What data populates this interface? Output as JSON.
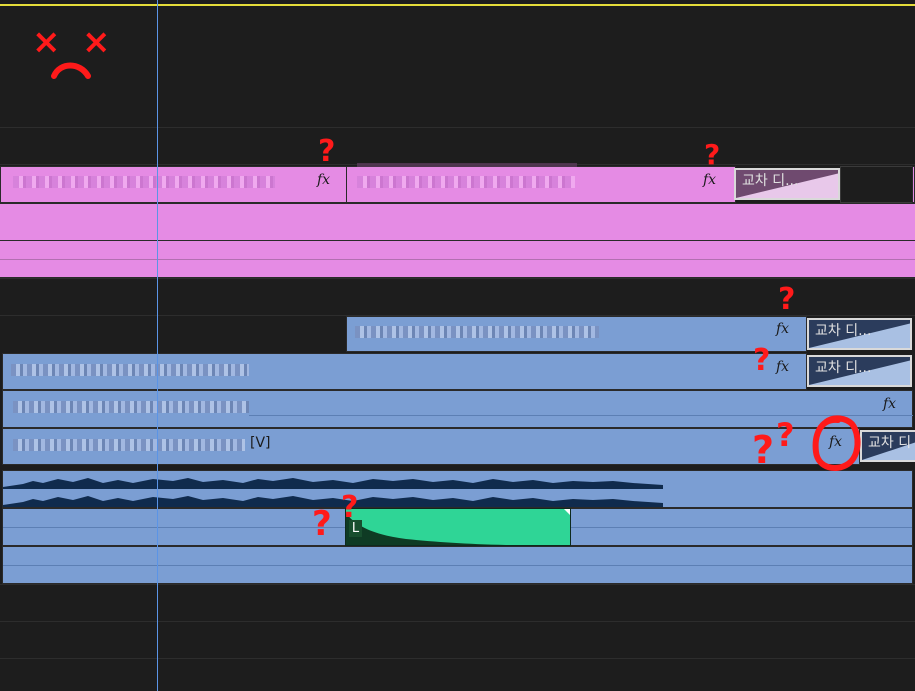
{
  "timeline": {
    "video_tracks": {
      "pink_clip_1": {
        "fx_label": "fx"
      },
      "pink_clip_2": {
        "fx_label": "fx"
      },
      "pink_transition": {
        "label": "교차 디..."
      },
      "blue_clip_a": {
        "fx_label": "fx"
      },
      "blue_transition_a": {
        "label": "교차 디..."
      },
      "blue_clip_b": {
        "fx_label": "fx"
      },
      "blue_transition_b": {
        "label": "교차 디..."
      },
      "blue_clip_c": {
        "fx_label": "fx"
      },
      "blue_clip_d": {
        "suffix": "[V]",
        "fx_label": "fx"
      },
      "blue_transition_d": {
        "label": "교차 디"
      }
    },
    "audio": {
      "keyframe_label": "L"
    }
  },
  "annotations": {
    "question_mark": "?",
    "x_mark": "×",
    "colors": {
      "red": "#ff1a1a",
      "pink_clip": "#e58be4",
      "blue_clip": "#7b9ed3",
      "green_clip": "#2fd596",
      "playhead": "#5b94e6"
    }
  }
}
